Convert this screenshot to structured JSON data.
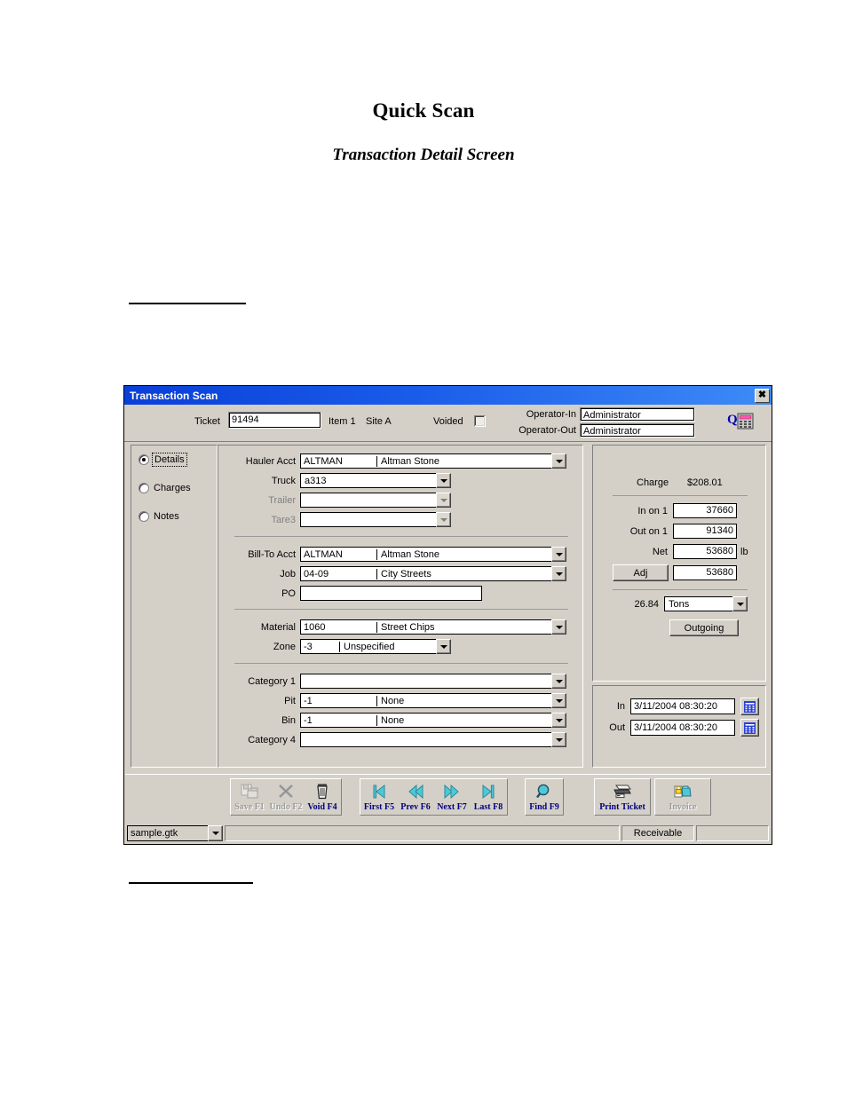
{
  "document": {
    "title": "Quick Scan",
    "subtitle": "Transaction Detail Screen"
  },
  "window": {
    "title": "Transaction Scan",
    "close_label": "✖"
  },
  "header": {
    "ticket_label": "Ticket",
    "ticket_value": "91494",
    "item_label": "Item 1",
    "site_label": "Site A",
    "voided_label": "Voided",
    "operator_in_label": "Operator-In",
    "operator_in_value": "Administrator",
    "operator_out_label": "Operator-Out",
    "operator_out_value": "Administrator"
  },
  "modes": [
    {
      "label": "Details",
      "selected": true
    },
    {
      "label": "Charges",
      "selected": false
    },
    {
      "label": "Notes",
      "selected": false
    }
  ],
  "form": {
    "group1": [
      {
        "label": "Hauler Acct",
        "code": "ALTMAN",
        "desc": "Altman Stone",
        "disabled": false
      },
      {
        "label": "Truck",
        "code": "a313",
        "desc": "",
        "disabled": false
      },
      {
        "label": "Trailer",
        "code": "",
        "desc": "",
        "disabled": true
      },
      {
        "label": "Tare3",
        "code": "",
        "desc": "",
        "disabled": true
      }
    ],
    "group2": [
      {
        "label": "Bill-To Acct",
        "code": "ALTMAN",
        "desc": "Altman Stone",
        "disabled": false
      },
      {
        "label": "Job",
        "code": "04-09",
        "desc": "City Streets",
        "disabled": false
      },
      {
        "label": "PO",
        "code": "",
        "desc": "",
        "disabled": false
      }
    ],
    "group3": [
      {
        "label": "Material",
        "code": "1060",
        "desc": "Street  Chips",
        "disabled": false
      },
      {
        "label": "Zone",
        "code": "-3",
        "desc": "Unspecified",
        "disabled": false
      }
    ],
    "group4": [
      {
        "label": "Category 1",
        "code": "",
        "desc": "",
        "disabled": false
      },
      {
        "label": "Pit",
        "code": "-1",
        "desc": "None",
        "disabled": false
      },
      {
        "label": "Bin",
        "code": "-1",
        "desc": "None",
        "disabled": false
      },
      {
        "label": "Category 4",
        "code": "",
        "desc": "",
        "disabled": false
      }
    ]
  },
  "weights": {
    "charge_label": "Charge",
    "charge_value": "$208.01",
    "in_label": "In on 1",
    "in_value": "37660",
    "out_label": "Out on 1",
    "out_value": "91340",
    "net_label": "Net",
    "net_value": "53680",
    "net_unit": "lb",
    "adj_label": "Adj",
    "adj_value": "53680",
    "converted_value": "26.84",
    "unit_selected": "Tons",
    "direction_label": "Outgoing"
  },
  "times": {
    "in_label": "In",
    "in_value": "3/11/2004 08:30:20",
    "out_label": "Out",
    "out_value": "3/11/2004 08:30:20",
    "calendar_icon": "calendar-icon"
  },
  "toolbar": {
    "groups": [
      {
        "buttons": [
          {
            "label": "Save F1",
            "icon": "save-icon",
            "disabled": true,
            "wide": false
          },
          {
            "label": "Undo F2",
            "icon": "undo-x-icon",
            "disabled": true,
            "wide": false
          },
          {
            "label": "Void F4",
            "icon": "trash-icon",
            "disabled": false,
            "wide": false
          }
        ]
      },
      {
        "buttons": [
          {
            "label": "First F5",
            "icon": "first-record-icon",
            "disabled": false,
            "wide": false
          },
          {
            "label": "Prev F6",
            "icon": "prev-record-icon",
            "disabled": false,
            "wide": false
          },
          {
            "label": "Next F7",
            "icon": "next-record-icon",
            "disabled": false,
            "wide": false
          },
          {
            "label": "Last F8",
            "icon": "last-record-icon",
            "disabled": false,
            "wide": false
          }
        ]
      },
      {
        "buttons": [
          {
            "label": "Find F9",
            "icon": "magnifier-icon",
            "disabled": false,
            "wide": false
          }
        ]
      },
      {
        "buttons": [
          {
            "label": "Print Ticket",
            "icon": "printer-icon",
            "disabled": false,
            "wide": true
          }
        ]
      },
      {
        "buttons": [
          {
            "label": "Invoice",
            "icon": "locked-folder-icon",
            "disabled": true,
            "wide": true
          }
        ]
      }
    ]
  },
  "statusbar": {
    "file_value": "sample.gtk",
    "message": "",
    "account_type": "Receivable",
    "extra": ""
  },
  "colors": {
    "titlebar_start": "#0a3fd8",
    "titlebar_end": "#3d8bf7",
    "window_face": "#d4d0c8",
    "caption_text": "#000080",
    "nav_icon": "#4ec8d8"
  }
}
